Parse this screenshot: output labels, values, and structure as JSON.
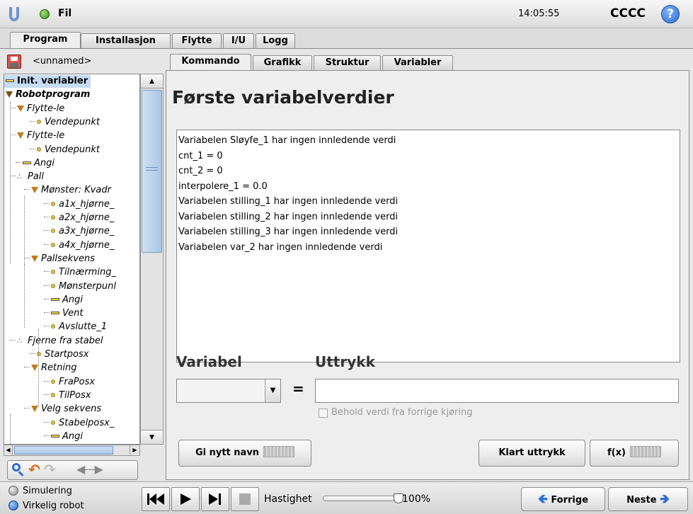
{
  "title_bar": {
    "file_label": "Fil",
    "clock": "14:05:55",
    "robot_name": "CCCC",
    "help": "?"
  },
  "main_tabs": [
    "Program",
    "Installasjon",
    "Flytte",
    "I/U",
    "Logg"
  ],
  "file": {
    "name": "<unnamed>"
  },
  "sub_tabs": [
    "Kommando",
    "Grafikk",
    "Struktur",
    "Variabler"
  ],
  "tree": [
    {
      "label": "Init. variabler",
      "icon": "dash",
      "selected": true
    },
    {
      "label": "Robotprogram",
      "icon": "triangle"
    },
    {
      "label": "Flytte-le",
      "icon": "triangle"
    },
    {
      "label": "Vendepunkt",
      "icon": "dot"
    },
    {
      "label": "Flytte-le",
      "icon": "triangle"
    },
    {
      "label": "Vendepunkt",
      "icon": "dot"
    },
    {
      "label": "Angi",
      "icon": "dash"
    },
    {
      "label": "Pall",
      "icon": "pallet"
    },
    {
      "label": "Mønster: Kvadr",
      "icon": "triangle"
    },
    {
      "label": "a1x_hjørne_",
      "icon": "dot"
    },
    {
      "label": "a2x_hjørne_",
      "icon": "dot"
    },
    {
      "label": "a3x_hjørne_",
      "icon": "dot"
    },
    {
      "label": "a4x_hjørne_",
      "icon": "dot"
    },
    {
      "label": "Pallsekvens",
      "icon": "triangle"
    },
    {
      "label": "Tilnærming_",
      "icon": "dot"
    },
    {
      "label": "Mønsterpunl",
      "icon": "dot"
    },
    {
      "label": "Angi",
      "icon": "dash"
    },
    {
      "label": "Vent",
      "icon": "dash"
    },
    {
      "label": "Avslutte_1",
      "icon": "dot"
    },
    {
      "label": "Fjerne fra stabel",
      "icon": "pallet"
    },
    {
      "label": "Startposx",
      "icon": "dot"
    },
    {
      "label": "Retning",
      "icon": "triangle"
    },
    {
      "label": "FraPosx",
      "icon": "dot"
    },
    {
      "label": "TilPosx",
      "icon": "dot"
    },
    {
      "label": "Velg sekvens",
      "icon": "triangle"
    },
    {
      "label": "Stabelposx_",
      "icon": "dot"
    },
    {
      "label": "Angi",
      "icon": "dash"
    }
  ],
  "panel": {
    "heading": "Første variabelverdier",
    "lines": [
      "Variabelen Sløyfe_1 har ingen innledende verdi",
      "cnt_1 = 0",
      "cnt_2 = 0",
      "interpolere_1 = 0.0",
      "Variabelen stilling_1 har ingen innledende verdi",
      "Variabelen stilling_2 har ingen innledende verdi",
      "Variabelen stilling_3 har ingen innledende verdi",
      "Variabelen var_2 har ingen innledende verdi"
    ],
    "variable_label": "Variabel",
    "expression_label": "Uttrykk",
    "equals": "=",
    "variable_value": "",
    "expression_value": "",
    "keep_value_label": "Behold verdi fra forrige kjøring",
    "rename_button": "Gi nytt navn",
    "clear_button": "Klart uttrykk",
    "fx_button": "f(x)"
  },
  "footer": {
    "simulation": "Simulering",
    "real_robot": "Virkelig robot",
    "speed_label": "Hastighet",
    "speed_value": "100%",
    "speed_fraction": 1.0,
    "prev_button": "Forrige",
    "next_button": "Neste"
  },
  "colors": {
    "selection": "#c6dcf3",
    "accent_blue": "#2e6fd0",
    "help_blue": "#3a7be0"
  }
}
